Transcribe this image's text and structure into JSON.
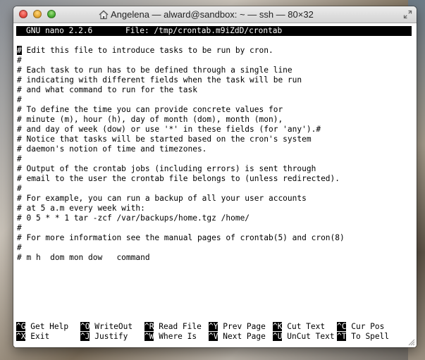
{
  "window": {
    "title": "Angelena — alward@sandbox: ~ — ssh — 80×32",
    "controls": {
      "close": "×",
      "minimize": "−",
      "zoom": "+"
    }
  },
  "nano": {
    "version": "GNU nano 2.2.6",
    "file_label": "File: /tmp/crontab.m9iZdD/crontab"
  },
  "editor": {
    "cursor_char": "#",
    "first_line_rest": " Edit this file to introduce tasks to be run by cron.",
    "lines": [
      "#",
      "# Each task to run has to be defined through a single line",
      "# indicating with different fields when the task will be run",
      "# and what command to run for the task",
      "#",
      "# To define the time you can provide concrete values for",
      "# minute (m), hour (h), day of month (dom), month (mon),",
      "# and day of week (dow) or use '*' in these fields (for 'any').#",
      "# Notice that tasks will be started based on the cron's system",
      "# daemon's notion of time and timezones.",
      "#",
      "# Output of the crontab jobs (including errors) is sent through",
      "# email to the user the crontab file belongs to (unless redirected).",
      "#",
      "# For example, you can run a backup of all your user accounts",
      "# at 5 a.m every week with:",
      "# 0 5 * * 1 tar -zcf /var/backups/home.tgz /home/",
      "#",
      "# For more information see the manual pages of crontab(5) and cron(8)",
      "#",
      "# m h  dom mon dow   command"
    ]
  },
  "shortcuts": {
    "row1": [
      {
        "key": "^G",
        "label": "Get Help"
      },
      {
        "key": "^O",
        "label": "WriteOut"
      },
      {
        "key": "^R",
        "label": "Read File"
      },
      {
        "key": "^Y",
        "label": "Prev Page"
      },
      {
        "key": "^K",
        "label": "Cut Text"
      },
      {
        "key": "^C",
        "label": "Cur Pos"
      }
    ],
    "row2": [
      {
        "key": "^X",
        "label": "Exit"
      },
      {
        "key": "^J",
        "label": "Justify"
      },
      {
        "key": "^W",
        "label": "Where Is"
      },
      {
        "key": "^V",
        "label": "Next Page"
      },
      {
        "key": "^U",
        "label": "UnCut Text"
      },
      {
        "key": "^T",
        "label": "To Spell"
      }
    ]
  }
}
